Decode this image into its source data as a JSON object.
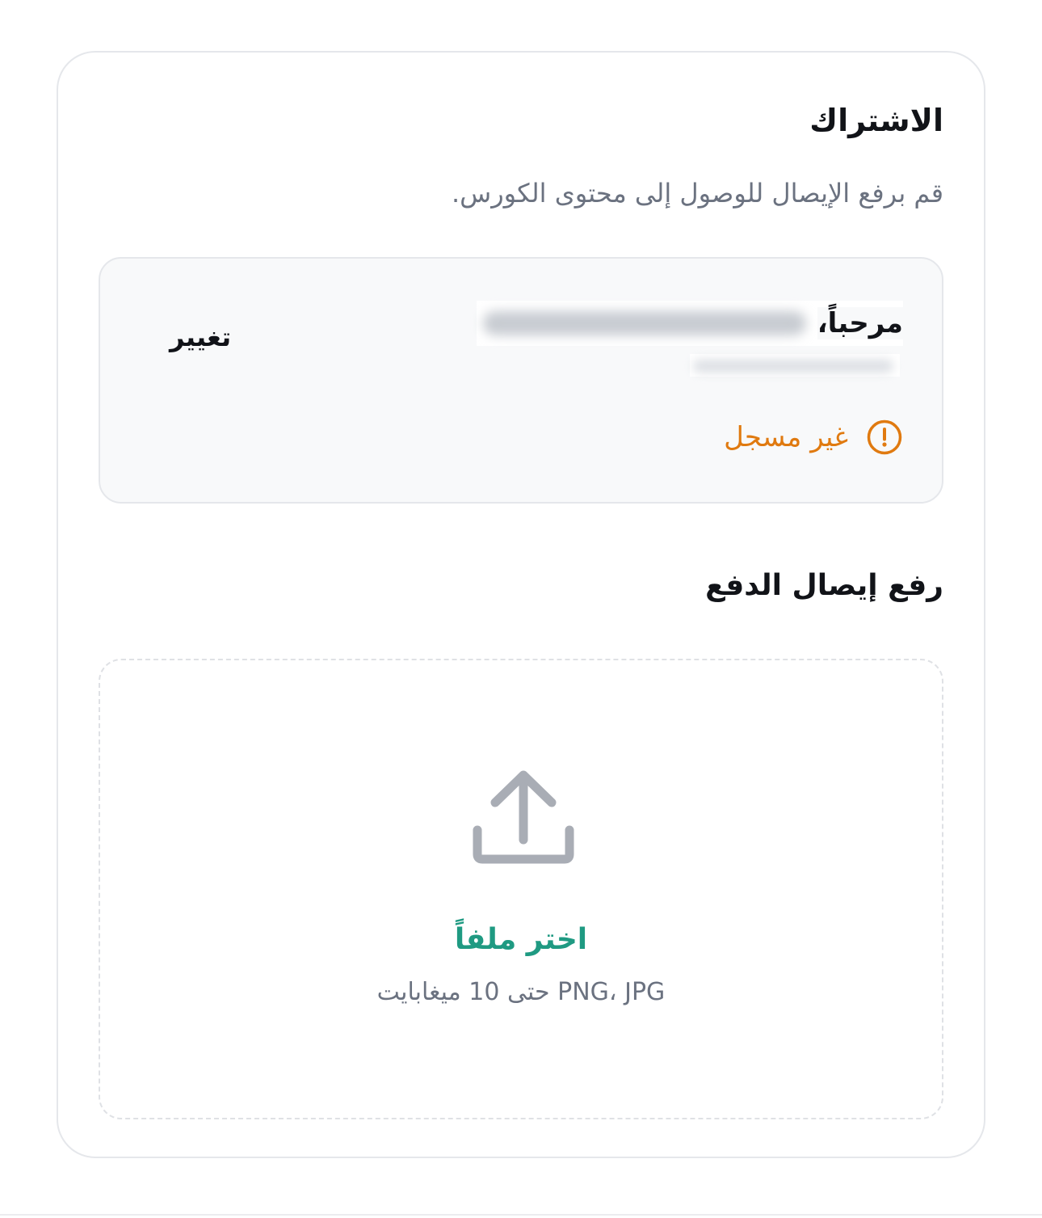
{
  "subscription": {
    "title": "الاشتراك",
    "subtitle": "قم برفع الإيصال للوصول إلى محتوى الكورس."
  },
  "user_card": {
    "greeting": "مرحباً،",
    "name_hidden": true,
    "phone_hidden": true,
    "change_label": "تغيير",
    "status_text": "غير مسجل",
    "status_icon": "alert-circle-icon",
    "status_color": "#e07a10"
  },
  "upload": {
    "section_title": "رفع إيصال الدفع",
    "icon": "upload-icon",
    "choose_label": "اختر ملفاً",
    "hint": "PNG، JPG حتى 10 ميغابايت",
    "accent_color": "#1f9a82"
  }
}
